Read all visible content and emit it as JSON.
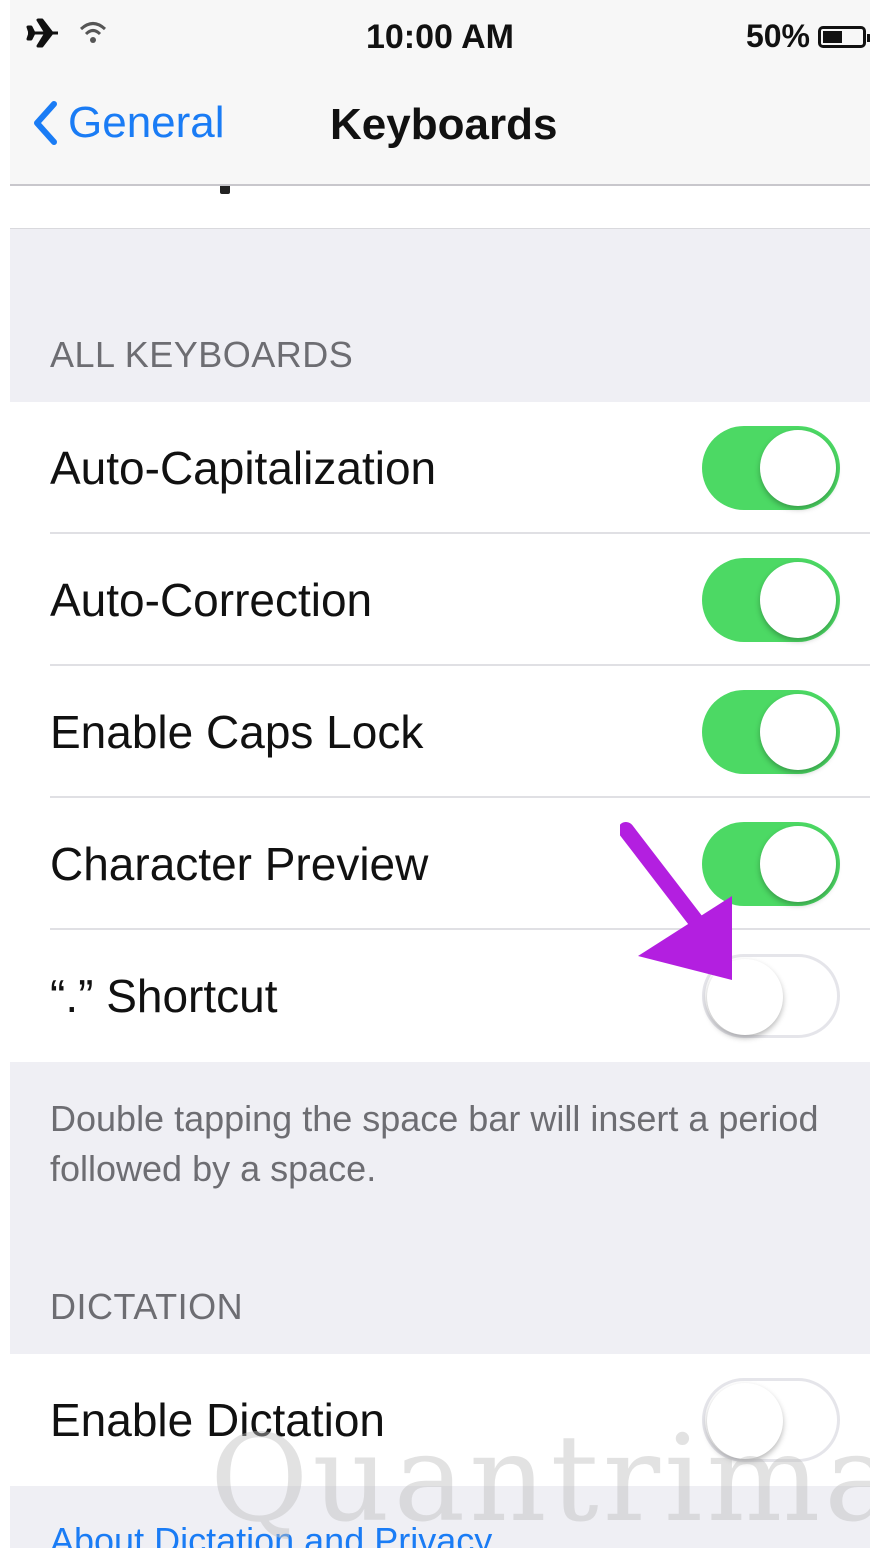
{
  "status_bar": {
    "time": "10:00 AM",
    "battery_percent": "50%",
    "battery_level": 0.5,
    "icons": [
      "airplane-icon",
      "wifi-icon",
      "battery-icon"
    ]
  },
  "nav": {
    "back_label": "General",
    "title": "Keyboards"
  },
  "sections": {
    "all_keyboards_header": "ALL KEYBOARDS",
    "dictation_header": "DICTATION"
  },
  "rows": [
    {
      "label": "Auto-Capitalization",
      "on": true
    },
    {
      "label": "Auto-Correction",
      "on": true
    },
    {
      "label": "Enable Caps Lock",
      "on": true
    },
    {
      "label": "Character Preview",
      "on": true
    },
    {
      "label": "“.” Shortcut",
      "on": false
    }
  ],
  "shortcut_footer": "Double tapping the space bar will insert a period followed by a space.",
  "dictation_row": {
    "label": "Enable Dictation",
    "on": false
  },
  "dictation_link": "About Dictation and Privacy...",
  "watermark": "Quantrimang",
  "colors": {
    "toggle_on": "#4cd964",
    "link": "#1a7cf5",
    "annotation_arrow": "#b31fe0"
  }
}
